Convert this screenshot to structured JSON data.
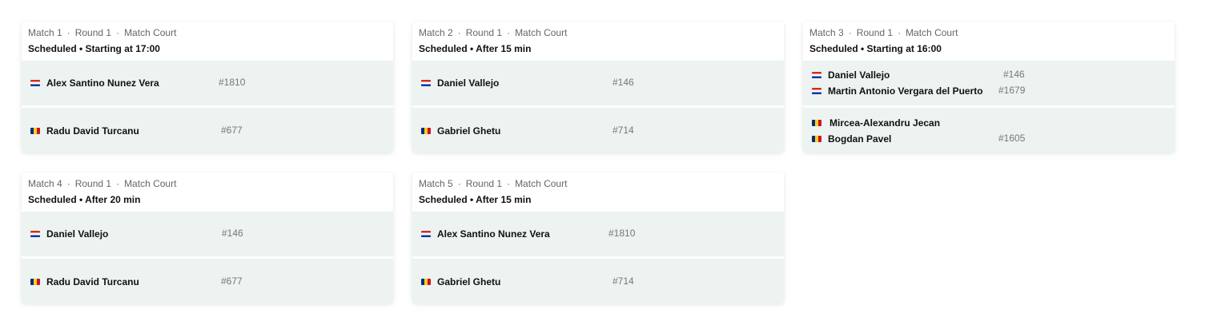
{
  "matches": [
    {
      "match_label": "Match 1",
      "round_label": "Round 1",
      "court_label": "Match Court",
      "sep": "·",
      "status": "Scheduled • Starting at 17:00",
      "team1": [
        {
          "name": "Alex Santino Nunez Vera",
          "seed": "#1810",
          "flag": "paraguay-flag-icon"
        }
      ],
      "team2": [
        {
          "name": "Radu David Turcanu",
          "seed": "#677",
          "flag": "romania-flag-icon"
        }
      ]
    },
    {
      "match_label": "Match 2",
      "round_label": "Round 1",
      "court_label": "Match Court",
      "sep": "·",
      "status": "Scheduled • After 15 min",
      "team1": [
        {
          "name": "Daniel Vallejo",
          "seed": "#146",
          "flag": "paraguay-flag-icon"
        }
      ],
      "team2": [
        {
          "name": "Gabriel Ghetu",
          "seed": "#714",
          "flag": "romania-flag-icon"
        }
      ]
    },
    {
      "match_label": "Match 3",
      "round_label": "Round 1",
      "court_label": "Match Court",
      "sep": "·",
      "status": "Scheduled • Starting at 16:00",
      "team1": [
        {
          "name": "Daniel Vallejo",
          "seed": "#146",
          "flag": "paraguay-flag-icon"
        },
        {
          "name": "Martin Antonio Vergara del Puerto",
          "seed": "#1679",
          "flag": "paraguay-flag-icon"
        }
      ],
      "team2": [
        {
          "name": "Mircea-Alexandru Jecan",
          "seed": "",
          "flag": "romania-flag-icon"
        },
        {
          "name": "Bogdan Pavel",
          "seed": "#1605",
          "flag": "romania-flag-icon"
        }
      ]
    },
    {
      "match_label": "Match 4",
      "round_label": "Round 1",
      "court_label": "Match Court",
      "sep": "·",
      "status": "Scheduled • After 20 min",
      "team1": [
        {
          "name": "Daniel Vallejo",
          "seed": "#146",
          "flag": "paraguay-flag-icon"
        }
      ],
      "team2": [
        {
          "name": "Radu David Turcanu",
          "seed": "#677",
          "flag": "romania-flag-icon"
        }
      ]
    },
    {
      "match_label": "Match 5",
      "round_label": "Round 1",
      "court_label": "Match Court",
      "sep": "·",
      "status": "Scheduled • After 15 min",
      "team1": [
        {
          "name": "Alex Santino Nunez Vera",
          "seed": "#1810",
          "flag": "paraguay-flag-icon"
        }
      ],
      "team2": [
        {
          "name": "Gabriel Ghetu",
          "seed": "#714",
          "flag": "romania-flag-icon"
        }
      ]
    }
  ],
  "colors": {
    "row_background": "#ecf3f0",
    "paraguay_red": "#d52b1e",
    "paraguay_blue": "#0038a8",
    "romania_blue": "#002b7f",
    "romania_yellow": "#fcd116",
    "romania_red": "#ce1126"
  }
}
